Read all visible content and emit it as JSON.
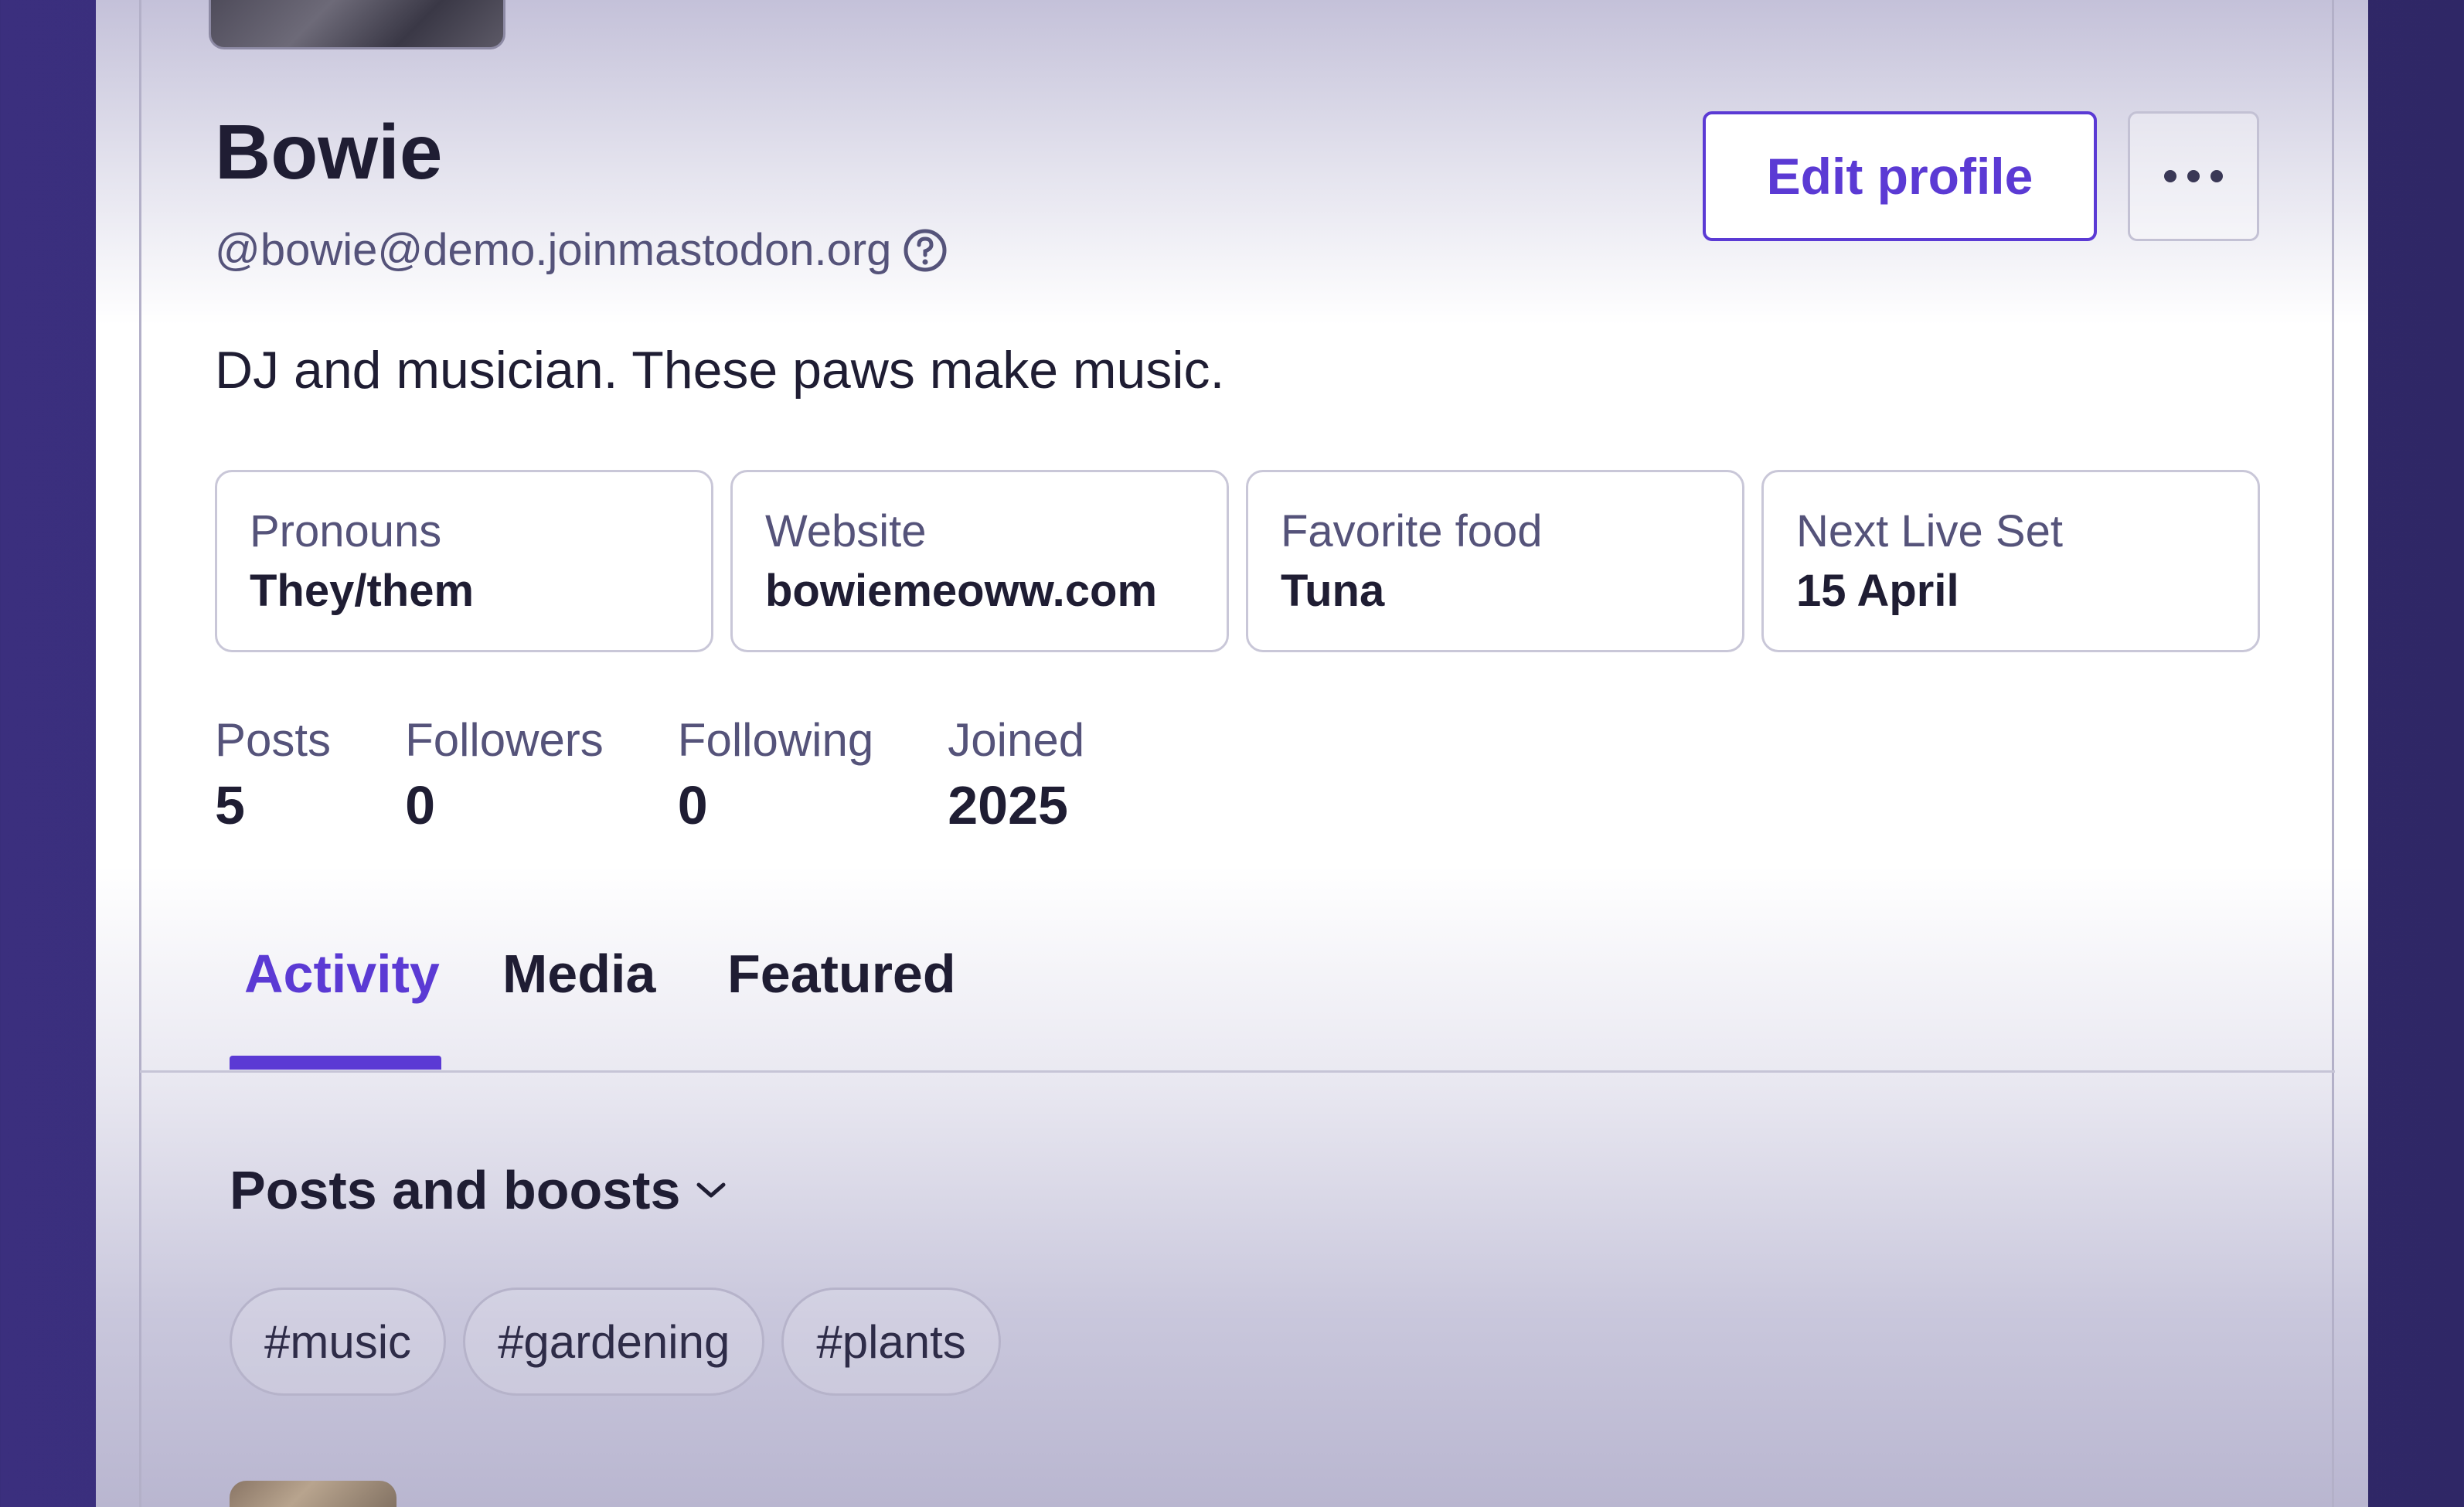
{
  "profile": {
    "display_name": "Bowie",
    "handle": "@bowie@demo.joinmastodon.org",
    "bio": "DJ and musician. These paws make music.",
    "edit_label": "Edit profile",
    "more_icon": "more-horizontal-icon",
    "help_icon": "help-circle-icon"
  },
  "fields": [
    {
      "label": "Pronouns",
      "value": "They/them"
    },
    {
      "label": "Website",
      "value": "bowiemeoww.com"
    },
    {
      "label": "Favorite food",
      "value": "Tuna"
    },
    {
      "label": "Next Live Set",
      "value": "15 April"
    }
  ],
  "stats": [
    {
      "label": "Posts",
      "value": "5"
    },
    {
      "label": "Followers",
      "value": "0"
    },
    {
      "label": "Following",
      "value": "0"
    },
    {
      "label": "Joined",
      "value": "2025"
    }
  ],
  "tabs": [
    {
      "label": "Activity",
      "active": true
    },
    {
      "label": "Media",
      "active": false
    },
    {
      "label": "Featured",
      "active": false
    }
  ],
  "filter": {
    "label": "Posts and boosts",
    "icon": "chevron-down-icon"
  },
  "hashtags": [
    "#music",
    "#gardening",
    "#plants"
  ],
  "colors": {
    "accent": "#5b3ad4",
    "text": "#1f1d33",
    "muted": "#55537a",
    "background": "#3b2f7e"
  }
}
